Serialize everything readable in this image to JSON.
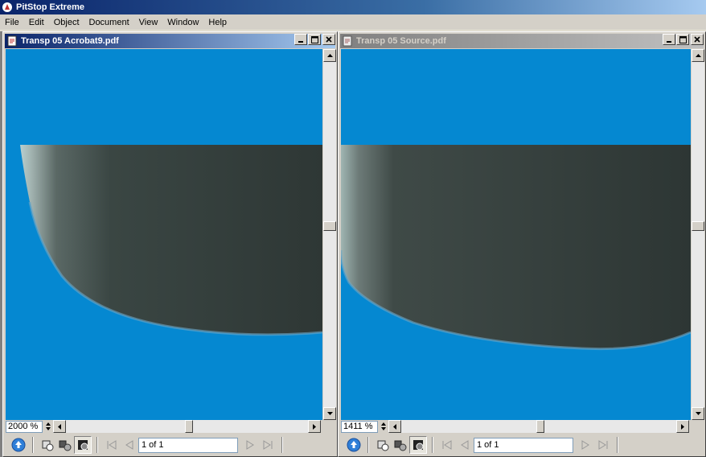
{
  "app": {
    "title": "PitStop Extreme",
    "menu": [
      "File",
      "Edit",
      "Object",
      "Document",
      "View",
      "Window",
      "Help"
    ]
  },
  "windows": [
    {
      "title": "Transp 05 Acrobat9.pdf",
      "active": true,
      "zoom": "2000 %",
      "page": "1 of 1"
    },
    {
      "title": "Transp 05 Source.pdf",
      "active": false,
      "zoom": "1411 %",
      "page": "1 of 1"
    }
  ],
  "colors": {
    "canvas_blue": "#0588d1",
    "shape_dark": "#313b38",
    "active_title": "#0a246a",
    "inactive_title": "#808080"
  },
  "icons": [
    "app-icon",
    "pdf-doc-icon",
    "minimize-icon",
    "restore-icon",
    "close-icon",
    "scroll-up-arrow-icon",
    "scroll-down-arrow-icon",
    "scroll-left-arrow-icon",
    "scroll-right-arrow-icon",
    "upload-icon",
    "select-object-icon",
    "select-group-icon",
    "preview-icon",
    "first-page-icon",
    "previous-page-icon",
    "next-page-icon",
    "last-page-icon"
  ]
}
